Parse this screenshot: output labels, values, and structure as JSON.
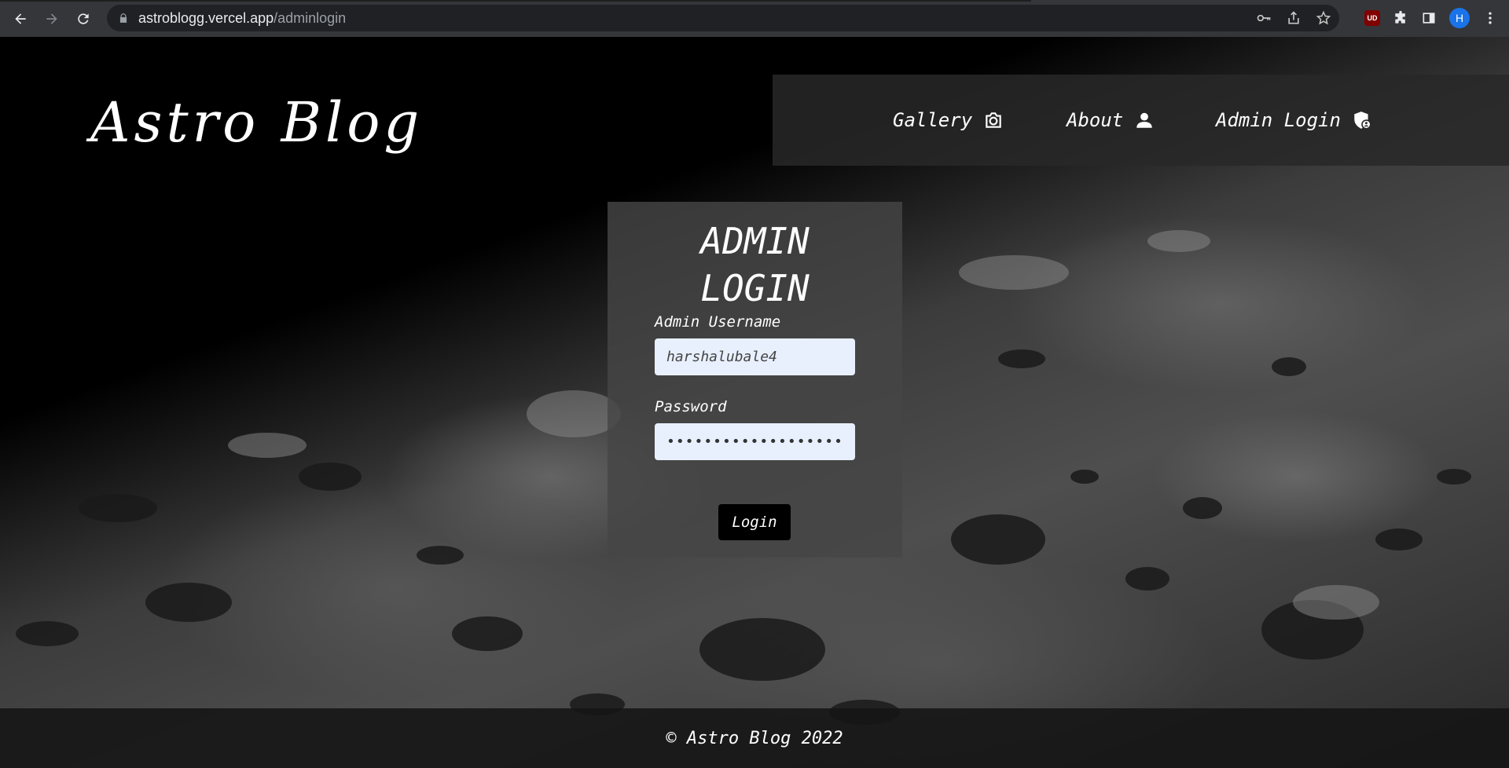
{
  "browser": {
    "url_host": "astroblogg.vercel.app",
    "url_path": "/adminlogin",
    "profile_initial": "H",
    "ublock_label": "UD"
  },
  "site": {
    "logo": "Astro Blog",
    "nav": [
      {
        "label": "Gallery",
        "icon": "camera-icon"
      },
      {
        "label": "About",
        "icon": "user-icon"
      },
      {
        "label": "Admin Login",
        "icon": "shield-user-icon"
      }
    ]
  },
  "login": {
    "title_line1": "ADMIN",
    "title_line2": "LOGIN",
    "username_label": "Admin Username",
    "username_value": "harshalubale4",
    "password_label": "Password",
    "password_value": "•••••••••••••••••••",
    "button_label": "Login"
  },
  "footer": {
    "text": "© Astro Blog 2022"
  },
  "colors": {
    "chrome_bg": "#35363a",
    "omnibox_bg": "#202124",
    "input_bg": "#e8f0fe",
    "button_bg": "#000000"
  }
}
